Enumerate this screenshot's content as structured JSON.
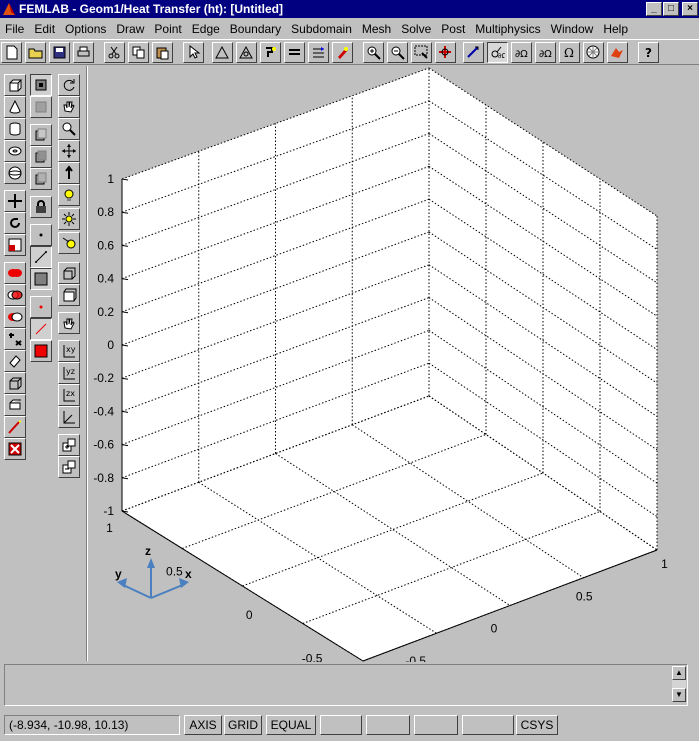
{
  "window": {
    "title": "FEMLAB - Geom1/Heat Transfer (ht): [Untitled]",
    "minimize_glyph": "_",
    "restore_glyph": "□",
    "close_glyph": "×"
  },
  "menu": [
    "File",
    "Edit",
    "Options",
    "Draw",
    "Point",
    "Edge",
    "Boundary",
    "Subdomain",
    "Mesh",
    "Solve",
    "Post",
    "Multiphysics",
    "Window",
    "Help"
  ],
  "toolbar_icons": [
    "new-file",
    "open-folder",
    "save",
    "print",
    "cut",
    "copy",
    "paste",
    "select-arrow",
    "draw-mode",
    "boundary-mode",
    "edge-mode",
    "subdomain-mode",
    "mesh-mode",
    "solve",
    "zoom-in",
    "zoom-out",
    "zoom-window",
    "zoom-extents",
    "post-plot",
    "edge-settings",
    "boundary-settings",
    "subdomain-settings",
    "equation-omega",
    "mesh-init",
    "matlab-export",
    "help"
  ],
  "axes": {
    "z_ticks": [
      "1",
      "0.8",
      "0.6",
      "0.4",
      "0.2",
      "0",
      "-0.2",
      "-0.4",
      "-0.6",
      "-0.8",
      "-1"
    ],
    "y_ticks": [
      "1",
      "0.5",
      "0",
      "-0.5"
    ],
    "x_ticks": [
      "1",
      "0.5",
      "0",
      "-0.5"
    ],
    "triad": {
      "x": "x",
      "y": "y",
      "z": "z"
    }
  },
  "colors": {
    "triad": "#4a7fc0",
    "grid": "#000000",
    "plot_bg": "#ffffff"
  },
  "command_line": {
    "value": ""
  },
  "status": {
    "coords": "(-8.934, -10.98, 10.13)",
    "axis": "AXIS",
    "grid": "GRID",
    "equal": "EQUAL",
    "blank1": "",
    "blank2": "",
    "blank3": "",
    "blank4": "",
    "csys": "CSYS"
  }
}
